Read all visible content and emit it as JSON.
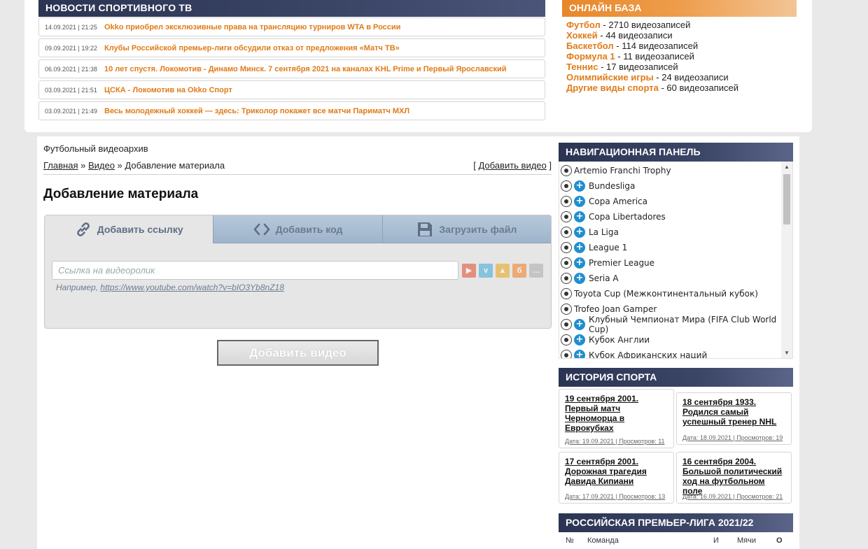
{
  "news": {
    "heading": "НОВОСТИ СПОРТИВНОГО ТВ",
    "items": [
      {
        "date": "14.09.2021 | 21:25",
        "title": "Okko приобрел эксклюзивные права на трансляцию турниров WTA в России"
      },
      {
        "date": "09.09.2021 | 19:22",
        "title": "Клубы Российской премьер-лиги обсудили отказ от предложения «Матч ТВ»"
      },
      {
        "date": "06.09.2021 | 21:38",
        "title": "10 лет спустя. Локомотив - Динамо Минск. 7 сентября 2021 на каналах KHL Prime и Первый Ярославский"
      },
      {
        "date": "03.09.2021 | 21:51",
        "title": "ЦСКА - Локомотив на Okko Спорт"
      },
      {
        "date": "03.09.2021 | 21:49",
        "title": "Весь молодежный хоккей — здесь: Триколор покажет все матчи Париматч МХЛ"
      }
    ]
  },
  "online": {
    "heading": "ОНЛАЙН БАЗА",
    "items": [
      {
        "sport": "Футбол",
        "count": " - 2710 видеозаписей"
      },
      {
        "sport": "Хоккей",
        "count": " - 44 видеозаписи"
      },
      {
        "sport": "Баскетбол",
        "count": " - 114 видеозаписей"
      },
      {
        "sport": "Формула 1",
        "count": " - 11 видеозаписей"
      },
      {
        "sport": "Теннис",
        "count": " - 17 видеозаписей"
      },
      {
        "sport": "Олимпийские игры",
        "count": " - 24 видеозаписи"
      },
      {
        "sport": "Другие виды спорта",
        "count": " - 60 видеозаписей"
      }
    ]
  },
  "content": {
    "section": "Футбольный видеоархив",
    "breadcrumb": {
      "home": "Главная",
      "sep": " » ",
      "video": "Видео",
      "current": "Добавление материала"
    },
    "add_video_link": "Добавить видео",
    "title": "Добавление материала",
    "tabs": [
      "Добавить ссылку",
      "Добавить код",
      "Загрузить файл"
    ],
    "url_placeholder": "Ссылка на видеоролик",
    "example_label": "Например, ",
    "example_url": "https://www.youtube.com/watch?v=bIO3Yb8nZ18",
    "submit": "Добавить видео"
  },
  "sidebar": {
    "nav_heading": "НАВИГАЦИОННАЯ ПАНЕЛЬ",
    "nav_items": [
      {
        "label": "Artemio Franchi Trophy",
        "plus": false
      },
      {
        "label": "Bundesliga",
        "plus": true
      },
      {
        "label": "Copa America",
        "plus": true
      },
      {
        "label": "Copa Libertadores",
        "plus": true
      },
      {
        "label": "La Liga",
        "plus": true
      },
      {
        "label": "League 1",
        "plus": true
      },
      {
        "label": "Premier League",
        "plus": true
      },
      {
        "label": "Seria A",
        "plus": true
      },
      {
        "label": "Toyota Cup (Межконтинентальный кубок)",
        "plus": false
      },
      {
        "label": "Trofeo Joan Gamper",
        "plus": false
      },
      {
        "label": "Клубный Чемпионат Мира (FIFA Club World Cup)",
        "plus": true
      },
      {
        "label": "Кубок Англии",
        "plus": true
      },
      {
        "label": "Кубок Африканских наций",
        "plus": true
      }
    ],
    "history_heading": "ИСТОРИЯ СПОРТА",
    "history": [
      {
        "title": "19 сентября 2001. Первый матч Черноморца в Еврокубках",
        "meta": "Дата: 19.09.2021 | Просмотров: 11"
      },
      {
        "title": "18 сентября 1933. Родился самый успешный тренер NHL",
        "meta": "Дата: 18.09.2021 | Просмотров: 19"
      },
      {
        "title": "17 сентября 2001. Дорожная трагедия Давида Кипиани",
        "meta": "Дата: 17.09.2021 | Просмотров: 13"
      },
      {
        "title": "16 сентября 2004. Большой политический ход на футбольном поле",
        "meta": "Дата: 16.09.2021 | Просмотров: 21"
      }
    ],
    "rpl_heading": "РОССИЙСКАЯ ПРЕМЬЕР-ЛИГА 2021/22",
    "rpl_cols": {
      "num": "№",
      "team": "Команда",
      "games": "И",
      "goals": "Мячи",
      "points": "О"
    }
  }
}
